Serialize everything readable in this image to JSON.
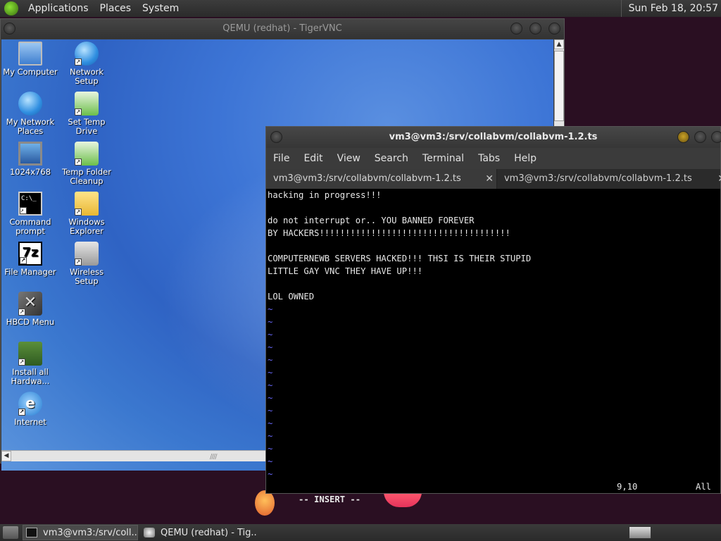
{
  "top_panel": {
    "menus": [
      "Applications",
      "Places",
      "System"
    ],
    "clock": "Sun Feb 18, 20:57"
  },
  "vnc_window": {
    "title": "QEMU (redhat) - TigerVNC",
    "scroll_up": "▲",
    "scroll_left": "◀",
    "grip": "////"
  },
  "desktop_icons": [
    {
      "label": "My Computer",
      "icon": "computer-icon",
      "glyph": ""
    },
    {
      "label": "Network Setup",
      "icon": "network-setup-icon",
      "glyph": ""
    },
    {
      "label": "My Network Places",
      "icon": "network-places-icon",
      "glyph": ""
    },
    {
      "label": "Set Temp Drive",
      "icon": "recycle-icon",
      "glyph": ""
    },
    {
      "label": "1024x768",
      "icon": "display-icon",
      "glyph": ""
    },
    {
      "label": "Temp Folder Cleanup",
      "icon": "recycle-bin-icon",
      "glyph": ""
    },
    {
      "label": "Command prompt",
      "icon": "command-prompt-icon",
      "glyph": "C:\\_"
    },
    {
      "label": "Windows Explorer",
      "icon": "folder-search-icon",
      "glyph": ""
    },
    {
      "label": "File Manager",
      "icon": "seven-zip-icon",
      "glyph": "7z"
    },
    {
      "label": "Wireless Setup",
      "icon": "wireless-icon",
      "glyph": ""
    },
    {
      "label": "HBCD Menu",
      "icon": "tools-icon",
      "glyph": "✕"
    },
    {
      "label": "Install all Hardwa...",
      "icon": "books-icon",
      "glyph": ""
    },
    {
      "label": "Internet",
      "icon": "internet-explorer-icon",
      "glyph": "e"
    }
  ],
  "terminal": {
    "title": "vm3@vm3:/srv/collabvm/collabvm-1.2.ts",
    "menu": [
      "File",
      "Edit",
      "View",
      "Search",
      "Terminal",
      "Tabs",
      "Help"
    ],
    "tabs": [
      {
        "label": "vm3@vm3:/srv/collabvm/collabvm-1.2.ts",
        "close": "✕"
      },
      {
        "label": "vm3@vm3:/srv/collabvm/collabvm-1.2.ts",
        "close": "✕"
      }
    ],
    "lines": [
      "hacking in progress!!!",
      "",
      "do not interrupt or.. YOU BANNED FOREVER",
      "BY HACKERS!!!!!!!!!!!!!!!!!!!!!!!!!!!!!!!!!!!!!",
      "",
      "COMPUTERNEWB SERVERS HACKED!!! THSI IS THEIR STUPID",
      "LITTLE GAY VNC THEY HAVE UP!!!",
      "",
      "LOL OWNED"
    ],
    "tilde": "~",
    "tilde_count": 14,
    "status_mode": "-- INSERT --",
    "status_pos": "9,10",
    "status_all": "All"
  },
  "taskbar": {
    "tasks": [
      {
        "label": "vm3@vm3:/srv/coll...",
        "active": true
      },
      {
        "label": "QEMU (redhat) - Tig...",
        "active": false
      }
    ]
  }
}
